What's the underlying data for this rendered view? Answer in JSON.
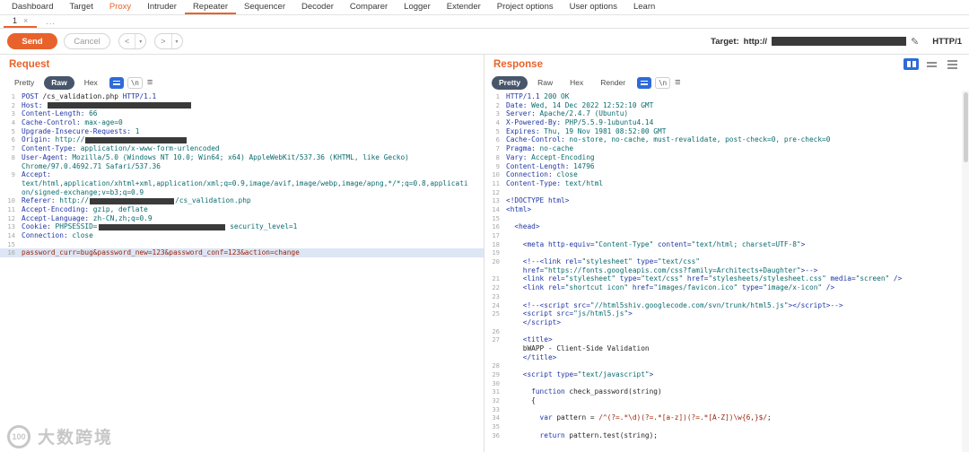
{
  "colors": {
    "accent": "#e8632c",
    "icon_blue": "#2e6bd9",
    "tab_active_bg": "#47566a",
    "selection_bg": "#dce6f5",
    "code_blue": "#1f35a5",
    "code_teal": "#0b6b6e",
    "code_dark": "#242424",
    "code_maroon": "#9b2408",
    "redact": "#3a3a3a"
  },
  "menubar": {
    "items": [
      {
        "label": "Dashboard"
      },
      {
        "label": "Target"
      },
      {
        "label": "Proxy",
        "highlight": true
      },
      {
        "label": "Intruder"
      },
      {
        "label": "Repeater",
        "active": true
      },
      {
        "label": "Sequencer"
      },
      {
        "label": "Decoder"
      },
      {
        "label": "Comparer"
      },
      {
        "label": "Logger"
      },
      {
        "label": "Extender"
      },
      {
        "label": "Project options"
      },
      {
        "label": "User options"
      },
      {
        "label": "Learn"
      }
    ]
  },
  "tabbar": {
    "tab_label": "1",
    "tab_close": "×",
    "more_label": "..."
  },
  "toolbar": {
    "send_label": "Send",
    "cancel_label": "Cancel",
    "back_label": "<",
    "forward_label": ">",
    "caret": "▾",
    "target_label": "Target:",
    "target_scheme": "http://",
    "pencil": "✎",
    "http_version": "HTTP/1"
  },
  "editor_icons": {
    "newline": "\\n",
    "menu": "≡"
  },
  "watermark": {
    "logo_text": "100",
    "text": "大数跨境"
  },
  "request": {
    "title": "Request",
    "tabs": [
      {
        "label": "Pretty"
      },
      {
        "label": "Raw",
        "active": true
      },
      {
        "label": "Hex"
      }
    ],
    "lines": [
      {
        "n": "1",
        "s": [
          [
            "b",
            "POST "
          ],
          [
            "d",
            "/cs_validation.php "
          ],
          [
            "b",
            "HTTP/1.1"
          ]
        ]
      },
      {
        "n": "2",
        "s": [
          [
            "b",
            "Host:"
          ],
          [
            "t",
            " "
          ],
          [
            "r",
            34
          ]
        ]
      },
      {
        "n": "3",
        "s": [
          [
            "b",
            "Content-Length:"
          ],
          [
            "t",
            " 66"
          ]
        ]
      },
      {
        "n": "4",
        "s": [
          [
            "b",
            "Cache-Control:"
          ],
          [
            "t",
            " max-age=0"
          ]
        ]
      },
      {
        "n": "5",
        "s": [
          [
            "b",
            "Upgrade-Insecure-Requests:"
          ],
          [
            "t",
            " 1"
          ]
        ]
      },
      {
        "n": "6",
        "s": [
          [
            "b",
            "Origin:"
          ],
          [
            "t",
            " http://"
          ],
          [
            "r",
            24
          ]
        ]
      },
      {
        "n": "7",
        "s": [
          [
            "b",
            "Content-Type:"
          ],
          [
            "t",
            " application/x-www-form-urlencoded"
          ]
        ]
      },
      {
        "n": "8",
        "s": [
          [
            "b",
            "User-Agent:"
          ],
          [
            "t",
            " Mozilla/5.0 (Windows NT 10.0; Win64; x64) AppleWebKit/537.36 (KHTML, like Gecko)"
          ]
        ]
      },
      {
        "n": "",
        "s": [
          [
            "t",
            "Chrome/97.0.4692.71 Safari/537.36"
          ]
        ]
      },
      {
        "n": "9",
        "s": [
          [
            "b",
            "Accept:"
          ]
        ]
      },
      {
        "n": "",
        "s": [
          [
            "t",
            "text/html,application/xhtml+xml,application/xml;q=0.9,image/avif,image/webp,image/apng,*/*;q=0.8,applicati"
          ]
        ]
      },
      {
        "n": "",
        "s": [
          [
            "t",
            "on/signed-exchange;v=b3;q=0.9"
          ]
        ]
      },
      {
        "n": "10",
        "s": [
          [
            "b",
            "Referer:"
          ],
          [
            "t",
            " http://"
          ],
          [
            "r",
            20
          ],
          [
            "t",
            "/cs_validation.php"
          ]
        ]
      },
      {
        "n": "11",
        "s": [
          [
            "b",
            "Accept-Encoding:"
          ],
          [
            "t",
            " gzip, deflate"
          ]
        ]
      },
      {
        "n": "12",
        "s": [
          [
            "b",
            "Accept-Language:"
          ],
          [
            "t",
            " zh-CN,zh;q=0.9"
          ]
        ]
      },
      {
        "n": "13",
        "s": [
          [
            "b",
            "Cookie:"
          ],
          [
            "t",
            " PHPSESSID="
          ],
          [
            "r",
            30
          ],
          [
            "t",
            " security_level=1"
          ]
        ]
      },
      {
        "n": "14",
        "s": [
          [
            "b",
            "Connection:"
          ],
          [
            "t",
            " close"
          ]
        ]
      },
      {
        "n": "15",
        "s": []
      },
      {
        "n": "16",
        "s": [
          [
            "m",
            "password_curr=bug&password_new=123&password_conf=123&action=change"
          ]
        ],
        "hl": true
      }
    ]
  },
  "response": {
    "title": "Response",
    "tabs": [
      {
        "label": "Pretty",
        "active": true
      },
      {
        "label": "Raw"
      },
      {
        "label": "Hex"
      },
      {
        "label": "Render"
      }
    ],
    "lines": [
      {
        "n": "1",
        "s": [
          [
            "b",
            "HTTP/1.1"
          ],
          [
            "t",
            " 200 OK"
          ]
        ]
      },
      {
        "n": "2",
        "s": [
          [
            "b",
            "Date:"
          ],
          [
            "t",
            " Wed, 14 Dec 2022 12:52:10 GMT"
          ]
        ]
      },
      {
        "n": "3",
        "s": [
          [
            "b",
            "Server:"
          ],
          [
            "t",
            " Apache/2.4.7 (Ubuntu)"
          ]
        ]
      },
      {
        "n": "4",
        "s": [
          [
            "b",
            "X-Powered-By:"
          ],
          [
            "t",
            " PHP/5.5.9-1ubuntu4.14"
          ]
        ]
      },
      {
        "n": "5",
        "s": [
          [
            "b",
            "Expires:"
          ],
          [
            "t",
            " Thu, 19 Nov 1981 08:52:00 GMT"
          ]
        ]
      },
      {
        "n": "6",
        "s": [
          [
            "b",
            "Cache-Control:"
          ],
          [
            "t",
            " no-store, no-cache, must-revalidate, post-check=0, pre-check=0"
          ]
        ]
      },
      {
        "n": "7",
        "s": [
          [
            "b",
            "Pragma:"
          ],
          [
            "t",
            " no-cache"
          ]
        ]
      },
      {
        "n": "8",
        "s": [
          [
            "b",
            "Vary:"
          ],
          [
            "t",
            " Accept-Encoding"
          ]
        ]
      },
      {
        "n": "9",
        "s": [
          [
            "b",
            "Content-Length:"
          ],
          [
            "t",
            " 14796"
          ]
        ]
      },
      {
        "n": "10",
        "s": [
          [
            "b",
            "Connection:"
          ],
          [
            "t",
            " close"
          ]
        ]
      },
      {
        "n": "11",
        "s": [
          [
            "b",
            "Content-Type:"
          ],
          [
            "t",
            " text/html"
          ]
        ]
      },
      {
        "n": "12",
        "s": []
      },
      {
        "n": "13",
        "s": [
          [
            "b",
            "<!DOCTYPE html>"
          ]
        ]
      },
      {
        "n": "14",
        "s": [
          [
            "b",
            "<html>"
          ]
        ]
      },
      {
        "n": "15",
        "s": []
      },
      {
        "n": "16",
        "s": [
          [
            "b",
            "  <head>"
          ]
        ]
      },
      {
        "n": "17",
        "s": []
      },
      {
        "n": "18",
        "s": [
          [
            "b",
            "    <meta http-equiv="
          ],
          [
            "t",
            "\"Content-Type\""
          ],
          [
            "b",
            " content="
          ],
          [
            "t",
            "\"text/html; charset=UTF-8\""
          ],
          [
            "b",
            ">"
          ]
        ]
      },
      {
        "n": "19",
        "s": []
      },
      {
        "n": "20",
        "s": [
          [
            "b",
            "    <!--<link rel="
          ],
          [
            "t",
            "\"stylesheet\""
          ],
          [
            "b",
            " type="
          ],
          [
            "t",
            "\"text/css\""
          ]
        ]
      },
      {
        "n": "",
        "s": [
          [
            "b",
            "    href="
          ],
          [
            "t",
            "\"https://fonts.googleapis.com/css?family=Architects+Daughter\""
          ],
          [
            "b",
            ">-->"
          ]
        ]
      },
      {
        "n": "21",
        "s": [
          [
            "b",
            "    <link rel="
          ],
          [
            "t",
            "\"stylesheet\""
          ],
          [
            "b",
            " type="
          ],
          [
            "t",
            "\"text/css\""
          ],
          [
            "b",
            " href="
          ],
          [
            "t",
            "\"stylesheets/stylesheet.css\""
          ],
          [
            "b",
            " media="
          ],
          [
            "t",
            "\"screen\""
          ],
          [
            "b",
            " />"
          ]
        ]
      },
      {
        "n": "22",
        "s": [
          [
            "b",
            "    <link rel="
          ],
          [
            "t",
            "\"shortcut icon\""
          ],
          [
            "b",
            " href="
          ],
          [
            "t",
            "\"images/favicon.ico\""
          ],
          [
            "b",
            " type="
          ],
          [
            "t",
            "\"image/x-icon\""
          ],
          [
            "b",
            " />"
          ]
        ]
      },
      {
        "n": "23",
        "s": []
      },
      {
        "n": "24",
        "s": [
          [
            "b",
            "    <!--<script src="
          ],
          [
            "t",
            "\"//html5shiv.googlecode.com/svn/trunk/html5.js\""
          ],
          [
            "b",
            "></script>-->"
          ]
        ]
      },
      {
        "n": "25",
        "s": [
          [
            "b",
            "    <script src="
          ],
          [
            "t",
            "\"js/html5.js\""
          ],
          [
            "b",
            ">"
          ]
        ]
      },
      {
        "n": "",
        "s": [
          [
            "b",
            "    </script>"
          ]
        ]
      },
      {
        "n": "26",
        "s": []
      },
      {
        "n": "27",
        "s": [
          [
            "b",
            "    <title>"
          ]
        ]
      },
      {
        "n": "",
        "s": [
          [
            "d",
            "    bWAPP - Client-Side Validation"
          ]
        ]
      },
      {
        "n": "",
        "s": [
          [
            "b",
            "    </title>"
          ]
        ]
      },
      {
        "n": "28",
        "s": []
      },
      {
        "n": "29",
        "s": [
          [
            "b",
            "    <script type="
          ],
          [
            "t",
            "\"text/javascript\""
          ],
          [
            "b",
            ">"
          ]
        ]
      },
      {
        "n": "30",
        "s": []
      },
      {
        "n": "31",
        "s": [
          [
            "b",
            "      function"
          ],
          [
            "d",
            " check_password(string)"
          ]
        ]
      },
      {
        "n": "32",
        "s": [
          [
            "d",
            "      {"
          ]
        ]
      },
      {
        "n": "33",
        "s": []
      },
      {
        "n": "34",
        "s": [
          [
            "b",
            "        var"
          ],
          [
            "d",
            " pattern = "
          ],
          [
            "m",
            "/^(?=.*\\d)(?=.*[a-z])(?=.*[A-Z])\\w{6,}$/"
          ],
          [
            "d",
            ";"
          ]
        ]
      },
      {
        "n": "35",
        "s": []
      },
      {
        "n": "36",
        "s": [
          [
            "b",
            "        return"
          ],
          [
            "d",
            " pattern.test(string);"
          ]
        ]
      }
    ]
  }
}
